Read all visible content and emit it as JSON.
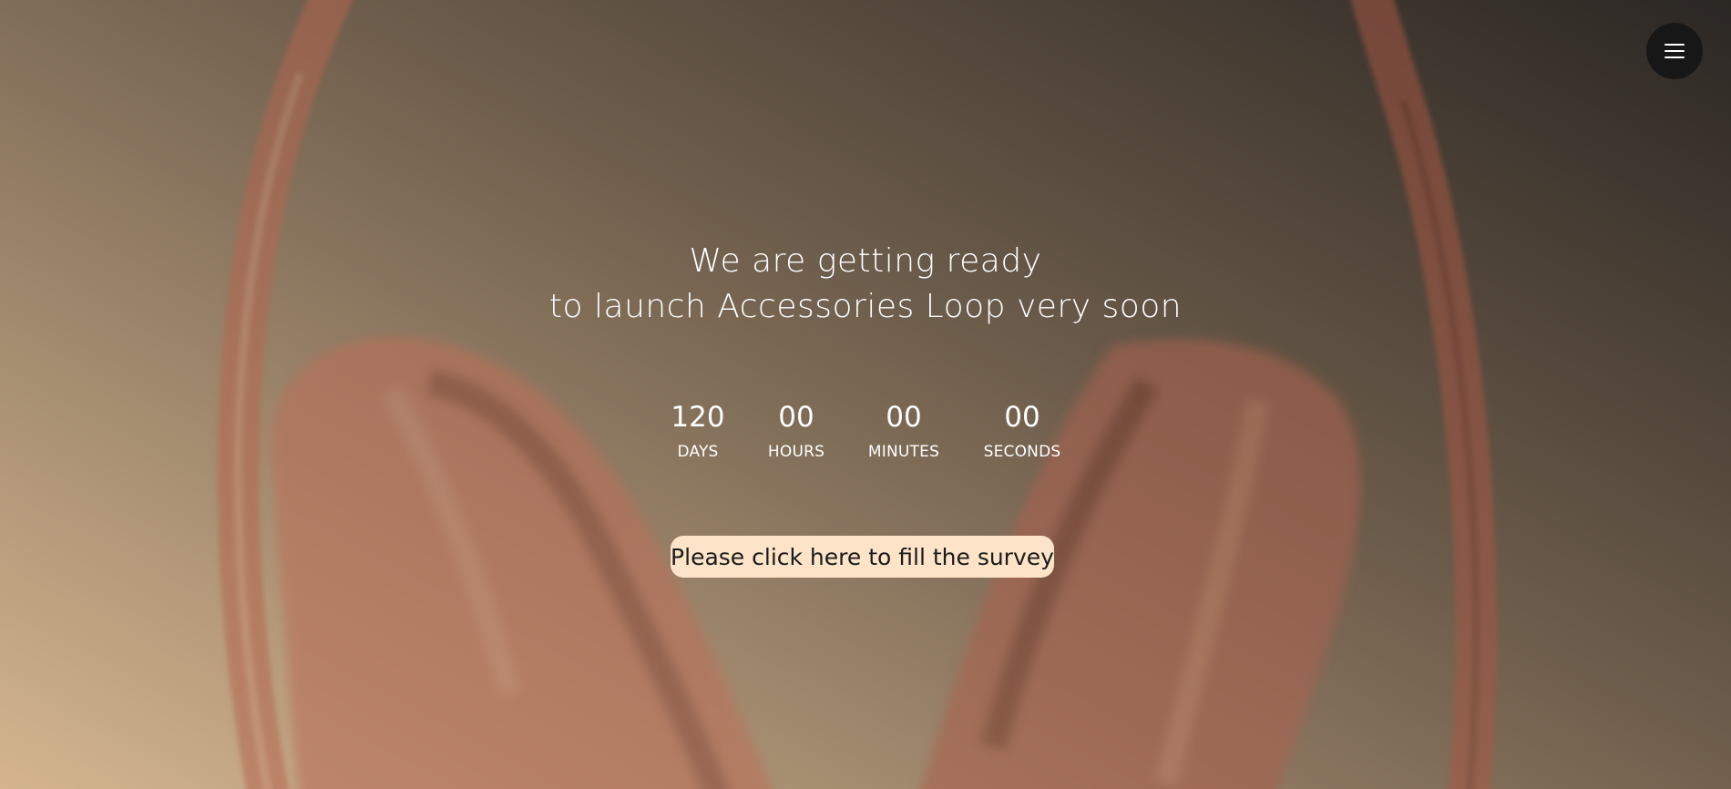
{
  "headline": {
    "line1": "We are getting ready",
    "line2": "to launch Accessories Loop very soon"
  },
  "countdown": {
    "days": {
      "value": "120",
      "label": "DAYS"
    },
    "hours": {
      "value": "00",
      "label": "HOURS"
    },
    "minutes": {
      "value": "00",
      "label": "MINUTES"
    },
    "seconds": {
      "value": "00",
      "label": "SECONDS"
    }
  },
  "survey": {
    "label": "Please click here to fill the survey"
  },
  "menu": {
    "icon": "hamburger-icon"
  },
  "colors": {
    "survey_button_bg": "#fde3c8",
    "menu_button_bg": "#171717",
    "headphones": "#b06a52"
  },
  "background": {
    "icon": "headphones-icon"
  }
}
